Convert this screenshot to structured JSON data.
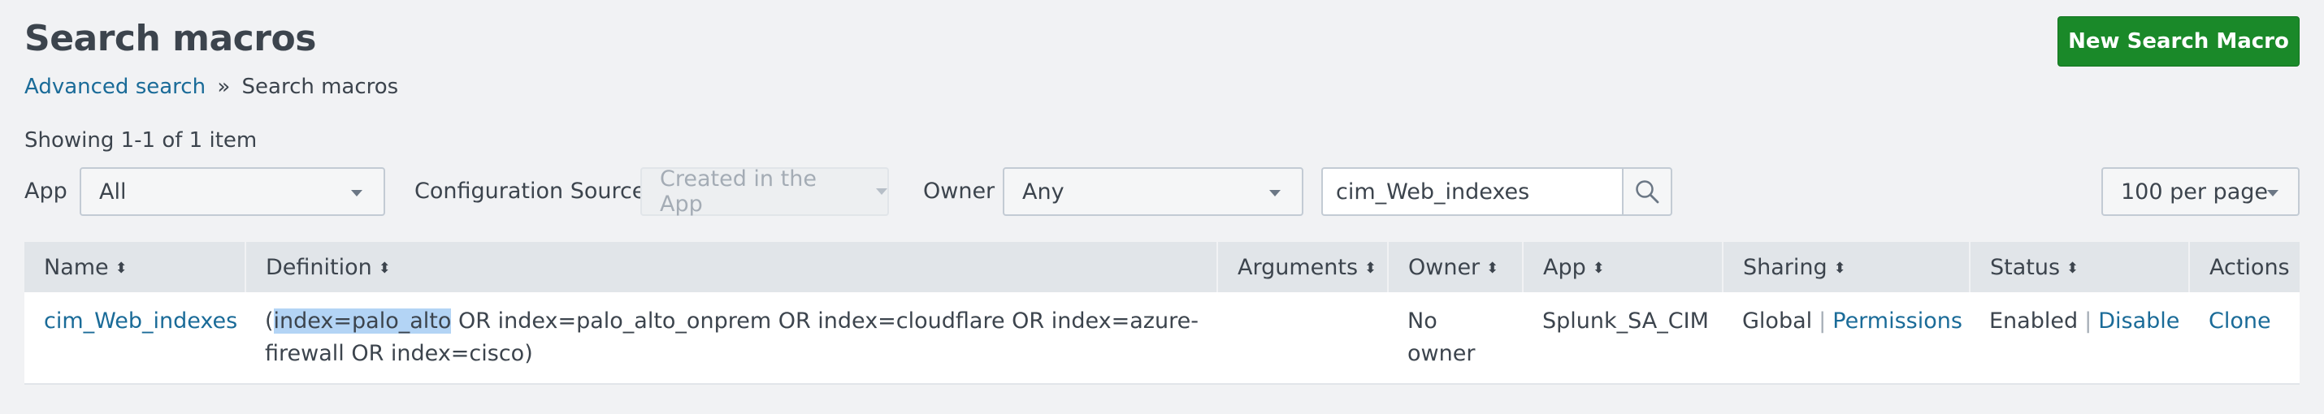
{
  "page": {
    "title": "Search macros",
    "new_button": "New Search Macro"
  },
  "breadcrumb": {
    "parent": "Advanced search",
    "separator": "»",
    "current": "Search macros"
  },
  "showing": "Showing 1-1 of 1 item",
  "filters": {
    "app_label": "App",
    "app_value": "All",
    "config_label": "Configuration Source",
    "config_value": "Created in the App",
    "owner_label": "Owner",
    "owner_value": "Any",
    "search_value": "cim_Web_indexes",
    "per_page": "100 per page"
  },
  "table": {
    "columns": [
      "Name",
      "Definition",
      "Arguments",
      "Owner",
      "App",
      "Sharing",
      "Status",
      "Actions"
    ],
    "rows": [
      {
        "name": "cim_Web_indexes",
        "definition_open": "(",
        "definition_selected": "index=palo_alto",
        "definition_rest": " OR index=palo_alto_onprem OR index=cloudflare OR index=azure-firewall OR index=cisco)",
        "arguments": "",
        "owner": "No owner",
        "app": "Splunk_SA_CIM",
        "sharing": "Global",
        "sharing_link": "Permissions",
        "status": "Enabled",
        "status_link": "Disable",
        "action": "Clone"
      }
    ]
  },
  "colors": {
    "accent_green": "#1a8929",
    "link_blue": "#1a6b98",
    "selection": "#b3d4f5",
    "header_bg": "#e1e5e9",
    "page_bg": "#f1f2f4"
  },
  "icons": {
    "search": "search-icon",
    "sort": "sort-icon",
    "caret": "chevron-down-icon"
  }
}
